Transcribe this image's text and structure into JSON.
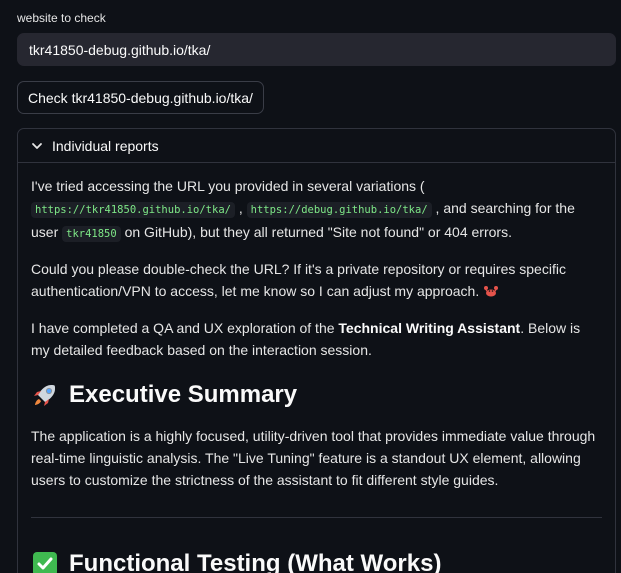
{
  "form": {
    "label": "website to check",
    "url_value": "tkr41850-debug.github.io/tka/",
    "button_label": "Check tkr41850-debug.github.io/tka/"
  },
  "expander": {
    "title": "Individual reports"
  },
  "report": {
    "p1_start": "I've tried accessing the URL you provided in several variations (",
    "p1_code1": "https://tkr41850.github.io/tka/",
    "p1_sep": ",",
    "p1_code2": "https://debug.github.io/tka/",
    "p1_mid": ", and searching for the user",
    "p1_code3": "tkr41850",
    "p1_end": "on GitHub), but they all returned \"Site not found\" or 404 errors.",
    "p2": "Could you please double-check the URL? If it's a private repository or requires specific authentication/VPN to access, let me know so I can adjust my approach.",
    "p3_start": "I have completed a QA and UX exploration of the",
    "p3_bold": "Technical Writing Assistant",
    "p3_end": ". Below is my detailed feedback based on the interaction session.",
    "h_exec": "Executive Summary",
    "p4": "The application is a highly focused, utility-driven tool that provides immediate value through real-time linguistic analysis. The \"Live Tuning\" feature is a standout UX element, allowing users to customize the strictness of the assistant to fit different style guides.",
    "h_func": "Functional Testing (What Works)"
  },
  "icons": {
    "chevron": "chevron-down-icon",
    "crab": "crab-icon",
    "rocket": "rocket-icon",
    "check": "check-mark-icon"
  },
  "colors": {
    "background": "#0e1117",
    "input_bg": "#262730",
    "code_text": "#7ee787",
    "check_green": "#3fb950"
  }
}
